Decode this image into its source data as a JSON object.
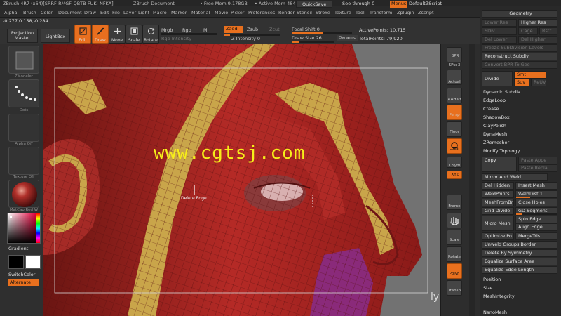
{
  "title": {
    "app": "ZBrush 4R7 (x64)[SRRF-RMGF-QBTB-FUKI-NFKA]",
    "document": "ZBrush Document",
    "free_mem": "• Free Mem 9.178GB",
    "active_mem": "• Active Mem 484"
  },
  "menus": [
    "Alpha",
    "Brush",
    "Color",
    "Document",
    "Draw",
    "Edit",
    "File",
    "Layer",
    "Light",
    "Macro",
    "Marker",
    "Material",
    "Movie",
    "Picker",
    "Preferences",
    "Render",
    "Stencil",
    "Stroke",
    "Texture",
    "Tool",
    "Transform",
    "Zplugin",
    "Zscript"
  ],
  "quick": {
    "quicksave": "QuickSave",
    "seethrough": "See-through  0",
    "menus": "Menus",
    "defaultzscript": "DefaultZScript"
  },
  "coords": "-0.277,0.158,-0.284",
  "toolbar": {
    "projection_master": "Projection Master",
    "lightbox": "LightBox",
    "edit": "Edit",
    "draw": "Draw",
    "move": "Move",
    "scale": "Scale",
    "rotate": "Rotate",
    "mrgb": "Mrgb",
    "rgb": "Rgb",
    "m": "M",
    "rgb_intensity": "Rgb Intensity",
    "zadd": "Zadd",
    "zsub": "Zsub",
    "zcut": "Zcut",
    "z_intensity": "Z Intensity 0",
    "focal_shift": "Focal Shift 0",
    "draw_size": "Draw Size 26",
    "dynamic": "Dynamic",
    "active_points": "ActivePoints: 10,715",
    "total_points": "TotalPoints: 79,920"
  },
  "left_shelf": {
    "brush_label": "ZModeler",
    "stroke_label": "Dots",
    "alpha_label": "Alpha Off",
    "texture_label": "Texture Off",
    "material_label": "MatCap Red W",
    "gradient": "Gradient",
    "switchcolor": "SwitchColor",
    "alternate": "Alternate"
  },
  "canvas": {
    "watermark": "www.cgtsj.com",
    "tooltip": "Delete Edge",
    "corner_logo": "lynda.com"
  },
  "right_shelf": {
    "bpr": "BPR",
    "spix": "SPix 3",
    "actual": "Actual",
    "aahalf": "AAHalf",
    "persp": "Persp",
    "floor": "Floor",
    "local": "Local",
    "lsym": "L.Sym",
    "xyz": "XYZ",
    "frame": "Frame",
    "move": "Move",
    "scale": "Scale",
    "rotate": "Rotate",
    "polyf": "PolyF",
    "transp": "Transp"
  },
  "panel": {
    "geometry": "Geometry",
    "lower_res": "Lower Res",
    "higher_res": "Higher Res",
    "sdiv": "SDiv",
    "cage": "Cage",
    "rstr": "Rstr",
    "del_lower": "Del Lower",
    "del_higher": "Del Higher",
    "freeze": "Freeze SubDivision Levels",
    "reconstruct": "Reconstruct Subdiv",
    "convert": "Convert BPR To Geo",
    "divide": "Divide",
    "smt": "Smt",
    "suv": "Suv",
    "reuv": "ReUV",
    "items_a": [
      "Dynamic Subdiv",
      "EdgeLoop",
      "Crease",
      "ShadowBox",
      "ClayPolish",
      "DynaMesh",
      "ZRemesher"
    ],
    "modify_topology": "Modify Topology",
    "copy": "Copy",
    "paste_append": "Paste Appe",
    "paste_replace": "Paste Repla",
    "mirror_weld": "Mirror And Weld",
    "del_hidden": "Del Hidden",
    "insert_mesh": "Insert Mesh",
    "weldpoints": "WeldPoints",
    "welddist": "WeldDist 1",
    "meshfrombrush": "MeshFromBr",
    "close_holes": "Close Holes",
    "grid_divide": "Grid Divide",
    "gd_segment": "GD Segment",
    "micro_mesh": "Micro Mesh",
    "spin_edge": "Spin Edge",
    "align_edge": "Align Edge",
    "optimize": "Optimize Po",
    "mergetris": "MergeTris",
    "unweld": "Unweld Groups Border",
    "delete_symmetry": "Delete By Symmetry",
    "equalize_area": "Equalize Surface Area",
    "equalize_edge": "Equalize Edge Length",
    "position": "Position",
    "size": "Size",
    "meshintegrity": "MeshIntegrity",
    "nanomesh": "NanoMesh"
  }
}
